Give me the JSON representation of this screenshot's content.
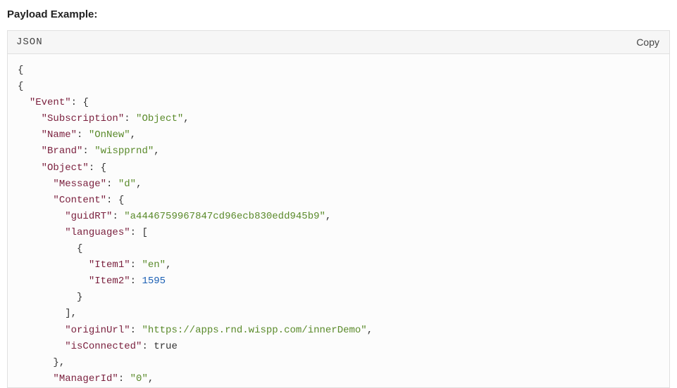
{
  "heading": "Payload Example:",
  "codebox": {
    "lang_label": "JSON",
    "copy_label": "Copy"
  },
  "code": {
    "l0": "{",
    "l1": "{",
    "ind1": "  ",
    "ind2": "    ",
    "ind3": "      ",
    "ind4": "        ",
    "ind5": "          ",
    "ind6": "            ",
    "k_event": "\"Event\"",
    "k_subscription": "\"Subscription\"",
    "k_name": "\"Name\"",
    "k_brand": "\"Brand\"",
    "k_object": "\"Object\"",
    "k_message": "\"Message\"",
    "k_content": "\"Content\"",
    "k_guidrt": "\"guidRT\"",
    "k_languages": "\"languages\"",
    "k_item1": "\"Item1\"",
    "k_item2": "\"Item2\"",
    "k_originurl": "\"originUrl\"",
    "k_isconnected": "\"isConnected\"",
    "k_managerid": "\"ManagerId\"",
    "v_object": "\"Object\"",
    "v_onnew": "\"OnNew\"",
    "v_brand": "\"wispprnd\"",
    "v_message": "\"d\"",
    "v_guidrt": "\"a4446759967847cd96ecb830edd945b9\"",
    "v_item1": "\"en\"",
    "v_item2": "1595",
    "v_originurl": "\"https://apps.rnd.wispp.com/innerDemo\"",
    "v_isconnected": "true",
    "v_managerid": "\"0\"",
    "colon": ": ",
    "comma": ",",
    "obr": "{",
    "cbr": "}",
    "obrk": "[",
    "cbrk": "]",
    "cbr_comma": "},",
    "cbrk_comma": "],"
  }
}
